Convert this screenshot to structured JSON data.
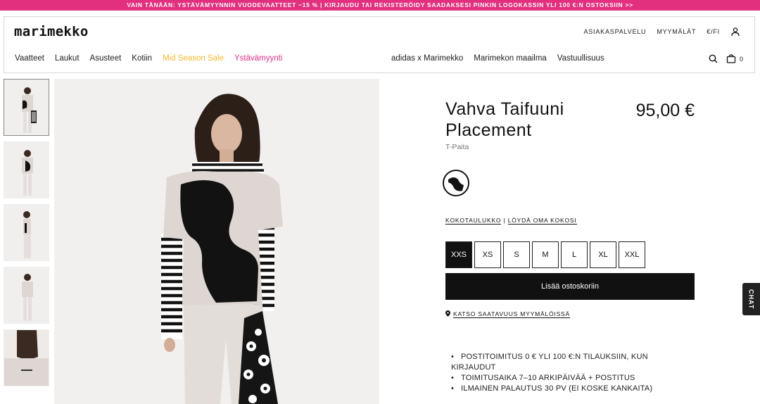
{
  "promo": {
    "text": "VAIN TÄNÄÄN: YSTÄVÄMYYNNIN VUODEVAATTEET −15 % | KIRJAUDU TAI REKISTERÖIDY SAADAKSESI PINKIN LOGOKASSIN YLI 100 €:N OSTOKSIIN >>",
    "color": "#e2307f"
  },
  "header": {
    "logo": "marimekko",
    "util": {
      "customer_service": "ASIAKASPALVELU",
      "stores": "MYYMÄLÄT",
      "locale": "€/FI",
      "account_icon": "user-icon"
    },
    "nav_left": [
      "Vaatteet",
      "Laukut",
      "Asusteet",
      "Kotiin",
      "Mid Season Sale",
      "Ystävämyynti"
    ],
    "nav_right": [
      "adidas x Marimekko",
      "Marimekon maailma",
      "Vastuullisuus"
    ],
    "search_icon": "search-icon",
    "cart_icon": "bag-icon",
    "cart_count": "0",
    "sale_color": "#f5b82e",
    "vday_color": "#e0308a"
  },
  "product": {
    "title": "Vahva Taifuuni Placement",
    "price": "95,00 €",
    "type": "T-Paita",
    "size_chart": "KOKOTAULUKKO",
    "separator": "|",
    "find_size": "LÖYDÄ OMA KOKOSI",
    "sizes": [
      "XXS",
      "XS",
      "S",
      "M",
      "L",
      "XL",
      "XXL"
    ],
    "selected_size": "XXS",
    "add_to_cart": "Lisää ostoskoriin",
    "availability": "KATSO SAATAVUUS MYYMÄLÖISSÄ",
    "info": [
      "POSTITOIMITUS 0 € YLI 100 €:N TILAUKSIIN, KUN KIRJAUDUT",
      "TOIMITUSAIKA 7–10 ARKIPÄIVÄÄ + POSTITUS",
      "ILMAINEN PALAUTUS 30 PV (EI KOSKE KANKAITA)"
    ]
  },
  "chat": "CHAT"
}
